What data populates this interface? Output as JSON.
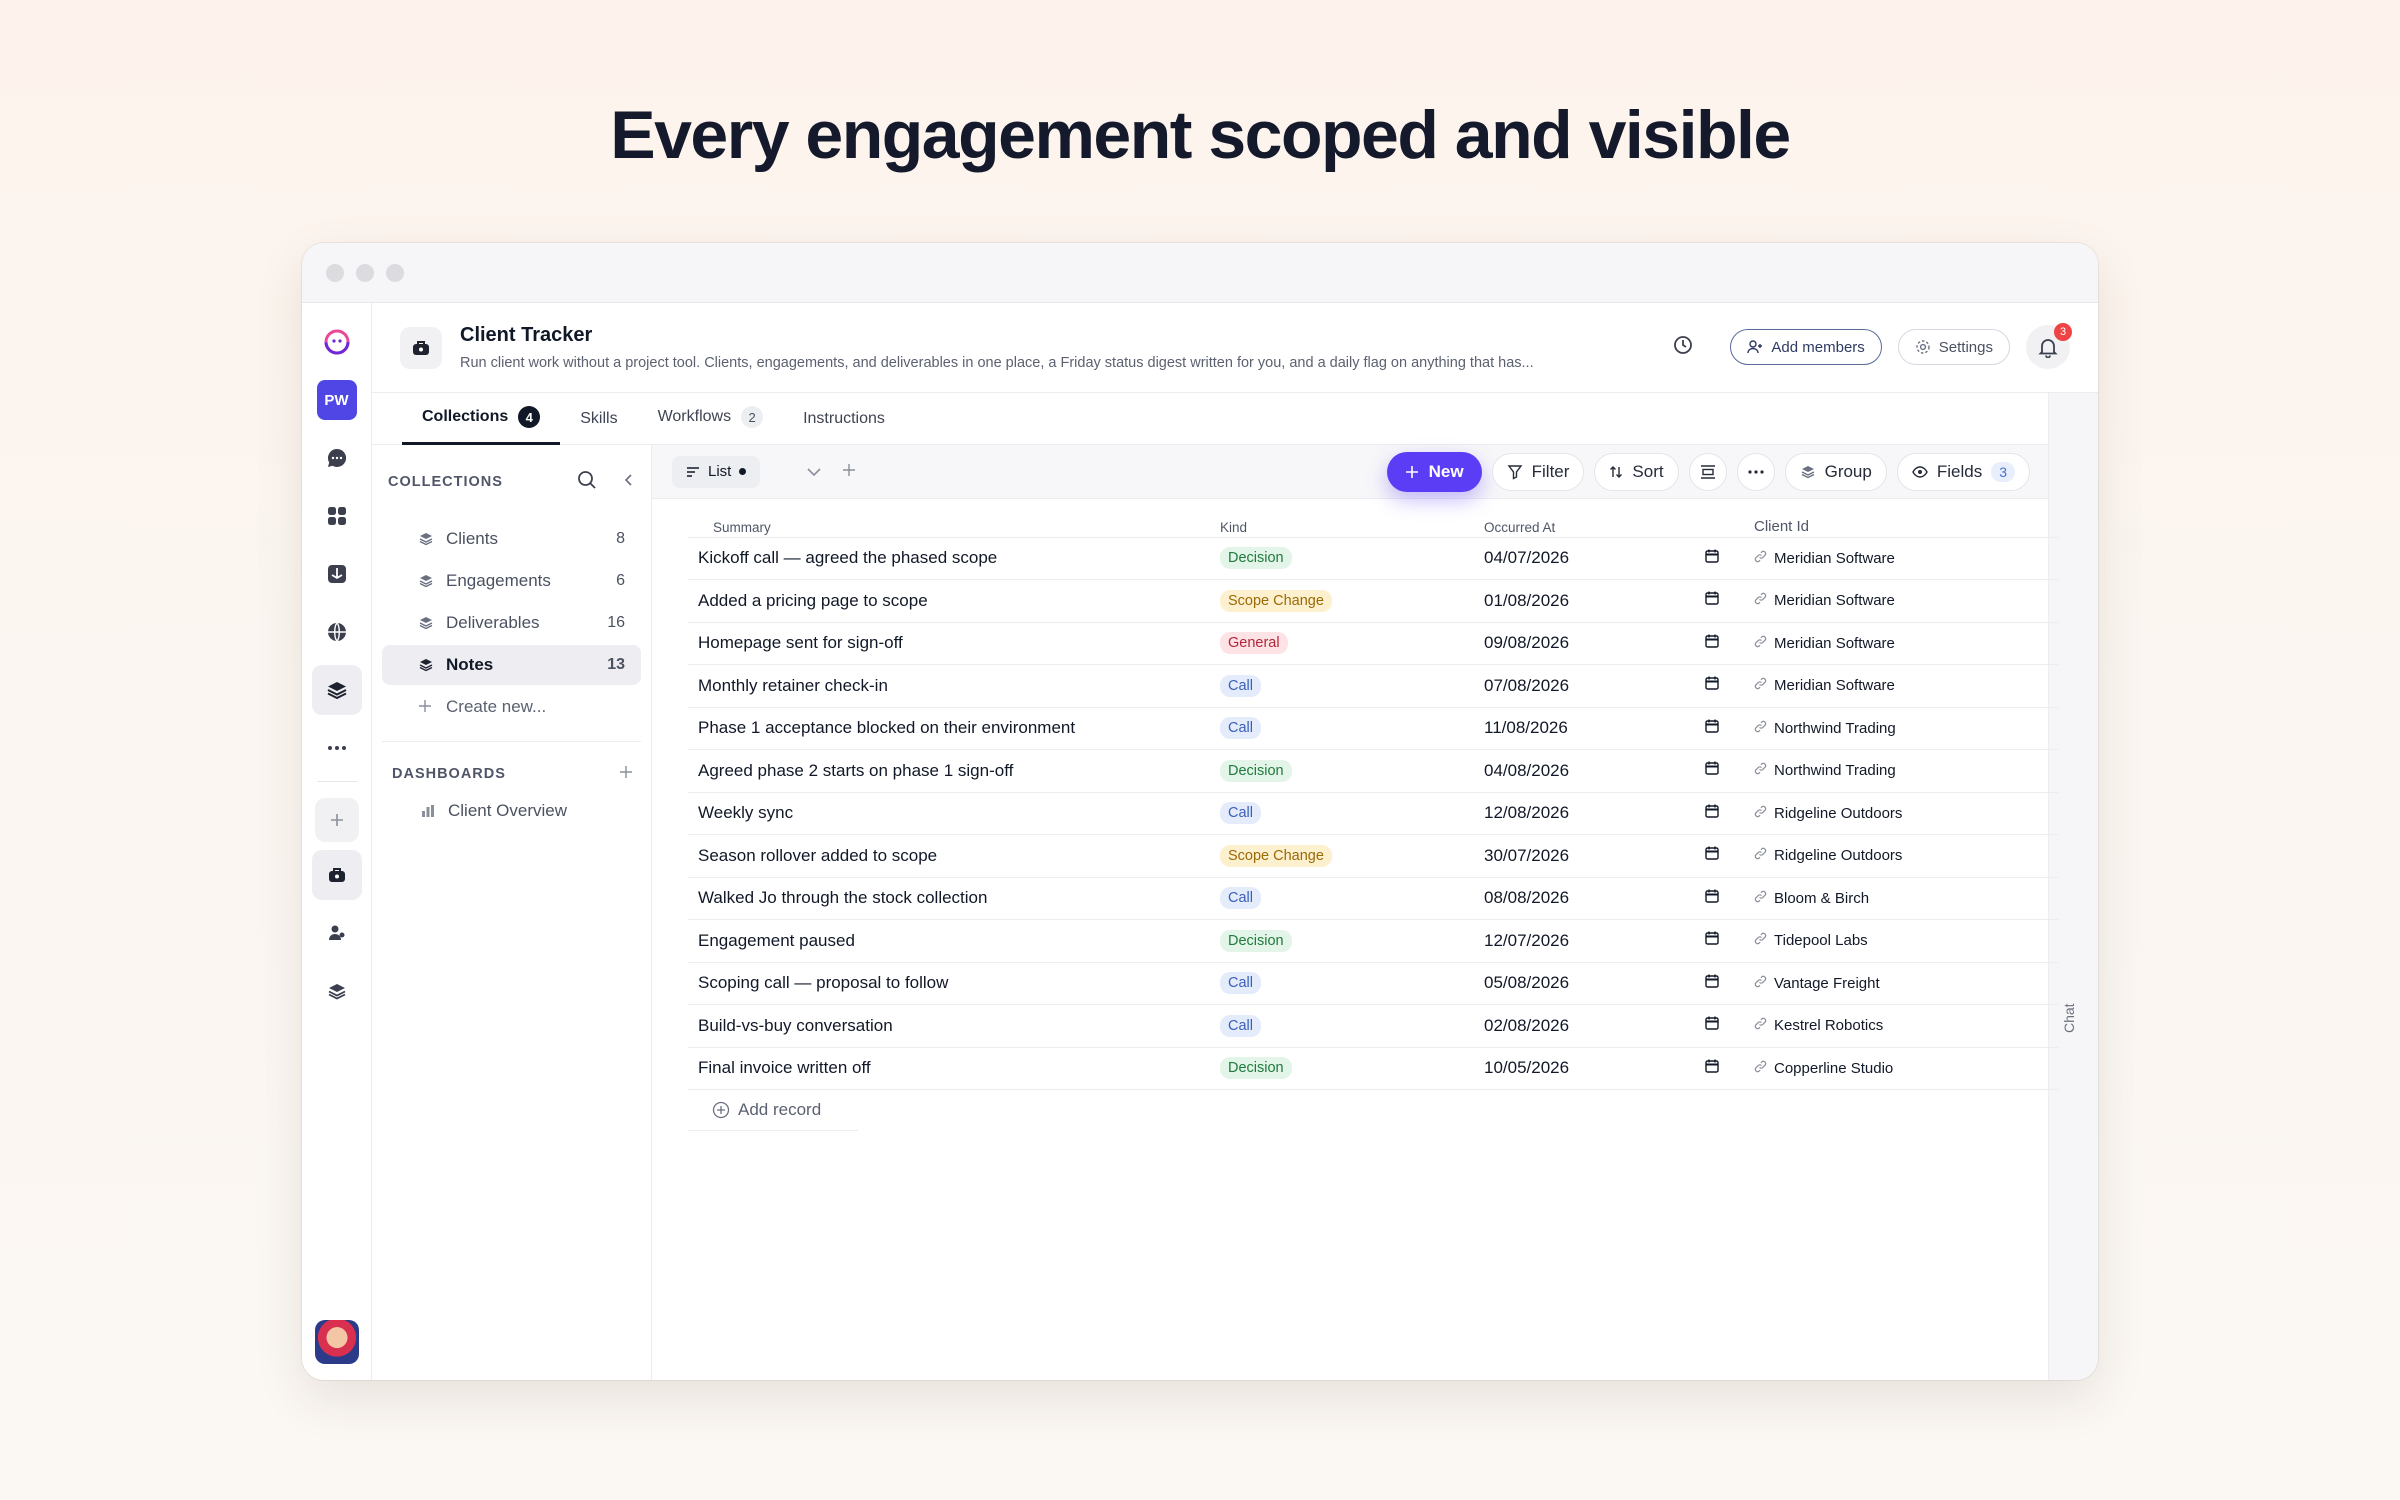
{
  "hero": {
    "title": "Every engagement scoped and visible"
  },
  "rail": {
    "workspace_initials": "PW"
  },
  "header": {
    "title": "Client Tracker",
    "description": "Run client work without a project tool. Clients, engagements, and deliverables in one place, a Friday status digest written for you, and a daily flag on anything that has...",
    "add_members_label": "Add members",
    "settings_label": "Settings",
    "notifications_count": "3"
  },
  "tabs": [
    {
      "label": "Collections",
      "count": "4"
    },
    {
      "label": "Skills",
      "count": ""
    },
    {
      "label": "Workflows",
      "count": "2"
    },
    {
      "label": "Instructions",
      "count": ""
    }
  ],
  "side_panel": {
    "chat_label": "Chat"
  },
  "collections": {
    "heading": "COLLECTIONS",
    "items": [
      {
        "label": "Clients",
        "count": "8"
      },
      {
        "label": "Engagements",
        "count": "6"
      },
      {
        "label": "Deliverables",
        "count": "16"
      },
      {
        "label": "Notes",
        "count": "13"
      }
    ],
    "create_label": "Create new...",
    "dashboards_heading": "DASHBOARDS",
    "dashboards": [
      {
        "label": "Client Overview"
      }
    ]
  },
  "toolbar": {
    "view_label": "List",
    "new_label": "New",
    "filter_label": "Filter",
    "sort_label": "Sort",
    "group_label": "Group",
    "fields_label": "Fields",
    "fields_count": "3"
  },
  "table": {
    "columns": [
      "Summary",
      "Kind",
      "Occurred At",
      "Client Id"
    ],
    "rows": [
      {
        "summary": "Kickoff call — agreed the phased scope",
        "kind": "Decision",
        "date": "04/07/2026",
        "client": "Meridian Software"
      },
      {
        "summary": "Added a pricing page to scope",
        "kind": "Scope Change",
        "date": "01/08/2026",
        "client": "Meridian Software"
      },
      {
        "summary": "Homepage sent for sign-off",
        "kind": "General",
        "date": "09/08/2026",
        "client": "Meridian Software"
      },
      {
        "summary": "Monthly retainer check-in",
        "kind": "Call",
        "date": "07/08/2026",
        "client": "Meridian Software"
      },
      {
        "summary": "Phase 1 acceptance blocked on their environment",
        "kind": "Call",
        "date": "11/08/2026",
        "client": "Northwind Trading"
      },
      {
        "summary": "Agreed phase 2 starts on phase 1 sign-off",
        "kind": "Decision",
        "date": "04/08/2026",
        "client": "Northwind Trading"
      },
      {
        "summary": "Weekly sync",
        "kind": "Call",
        "date": "12/08/2026",
        "client": "Ridgeline Outdoors"
      },
      {
        "summary": "Season rollover added to scope",
        "kind": "Scope Change",
        "date": "30/07/2026",
        "client": "Ridgeline Outdoors"
      },
      {
        "summary": "Walked Jo through the stock collection",
        "kind": "Call",
        "date": "08/08/2026",
        "client": "Bloom & Birch"
      },
      {
        "summary": "Engagement paused",
        "kind": "Decision",
        "date": "12/07/2026",
        "client": "Tidepool Labs"
      },
      {
        "summary": "Scoping call — proposal to follow",
        "kind": "Call",
        "date": "05/08/2026",
        "client": "Vantage Freight"
      },
      {
        "summary": "Build-vs-buy conversation",
        "kind": "Call",
        "date": "02/08/2026",
        "client": "Kestrel Robotics"
      },
      {
        "summary": "Final invoice written off",
        "kind": "Decision",
        "date": "10/05/2026",
        "client": "Copperline Studio"
      }
    ],
    "add_record_label": "Add record"
  },
  "kind_colors": {
    "Decision": {
      "bg": "#e3f5e8",
      "fg": "#1f7a3d"
    },
    "Scope Change": {
      "bg": "#fdf0cf",
      "fg": "#9a6a05"
    },
    "General": {
      "bg": "#fde3e5",
      "fg": "#b3263a"
    },
    "Call": {
      "bg": "#e4ecfb",
      "fg": "#3b5fb8"
    }
  },
  "colors": {
    "accent": "#5b3df5",
    "workspace": "#4f46e5"
  }
}
